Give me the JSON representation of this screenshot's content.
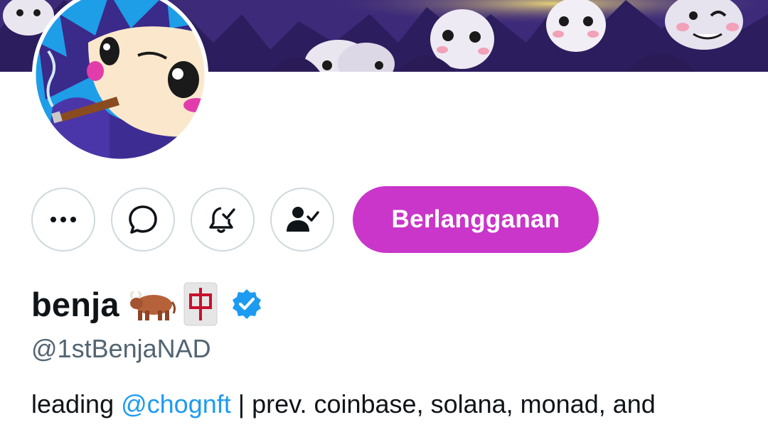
{
  "banner": {
    "description_icon": "mascot-crowd-banner",
    "background_color": "#3d2a79"
  },
  "avatar": {
    "icon": "mascot-avatar"
  },
  "actions": {
    "more_icon": "more-dots-icon",
    "message_icon": "message-bubble-icon",
    "notify_icon": "bell-check-icon",
    "following_icon": "person-check-icon",
    "subscribe_label": "Berlangganan",
    "subscribe_color": "#c936c9"
  },
  "profile": {
    "display_name": "benja",
    "name_emojis": [
      "ox-emoji",
      "mahjong-red-dragon-emoji"
    ],
    "verified_color": "#1d9bf0",
    "handle": "@1stBenjaNAD",
    "bio": {
      "prefix": "leading ",
      "mention": "@chognft",
      "suffix": " | prev. coinbase, solana, monad, and"
    }
  },
  "colors": {
    "text_primary": "#0f1419",
    "text_secondary": "#536471",
    "link": "#1d9bf0",
    "border": "#cfd9de"
  }
}
